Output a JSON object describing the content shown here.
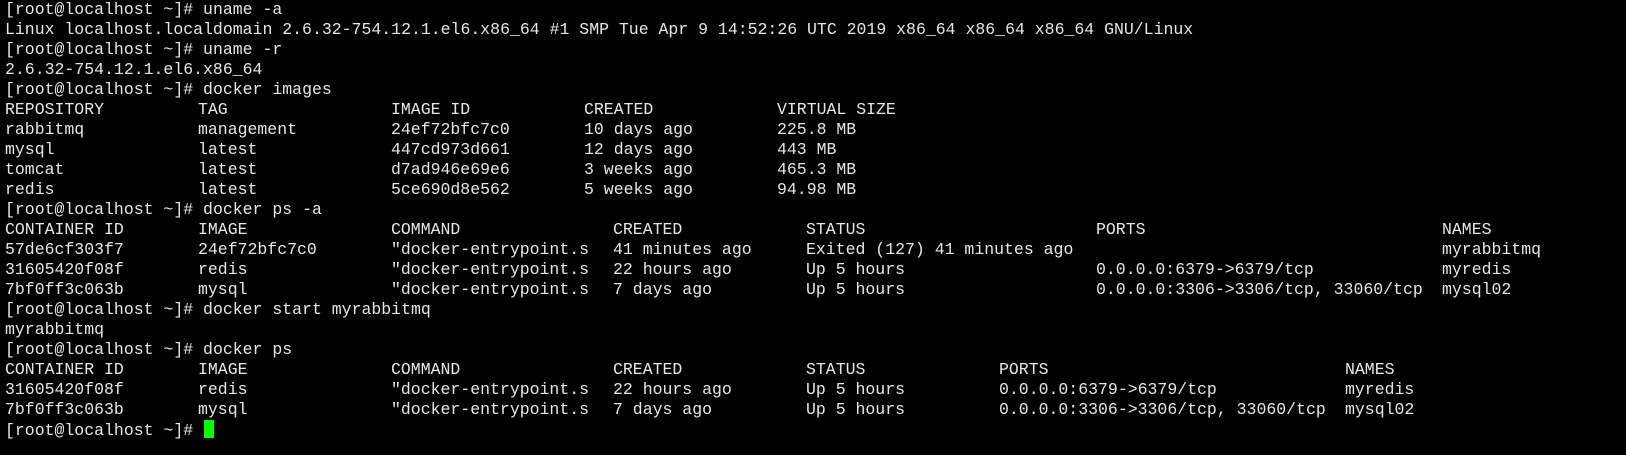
{
  "terminal": {
    "cursor_color": "#00ff00",
    "prompt": "[root@localhost ~]#",
    "lines": [
      {
        "kind": "prompt",
        "cmd": "uname -a"
      },
      {
        "kind": "text",
        "text": "Linux localhost.localdomain 2.6.32-754.12.1.el6.x86_64 #1 SMP Tue Apr 9 14:52:26 UTC 2019 x86_64 x86_64 x86_64 GNU/Linux"
      },
      {
        "kind": "prompt",
        "cmd": "uname -r"
      },
      {
        "kind": "text",
        "text": "2.6.32-754.12.1.el6.x86_64"
      },
      {
        "kind": "prompt",
        "cmd": "docker images"
      },
      {
        "kind": "row",
        "table": "images",
        "cells": [
          "REPOSITORY",
          "TAG",
          "IMAGE ID",
          "CREATED",
          "VIRTUAL SIZE"
        ]
      },
      {
        "kind": "row",
        "table": "images",
        "cells": [
          "rabbitmq",
          "management",
          "24ef72bfc7c0",
          "10 days ago",
          "225.8 MB"
        ]
      },
      {
        "kind": "row",
        "table": "images",
        "cells": [
          "mysql",
          "latest",
          "447cd973d661",
          "12 days ago",
          "443 MB"
        ]
      },
      {
        "kind": "row",
        "table": "images",
        "cells": [
          "tomcat",
          "latest",
          "d7ad946e69e6",
          "3 weeks ago",
          "465.3 MB"
        ]
      },
      {
        "kind": "row",
        "table": "images",
        "cells": [
          "redis",
          "latest",
          "5ce690d8e562",
          "5 weeks ago",
          "94.98 MB"
        ]
      },
      {
        "kind": "prompt",
        "cmd": "docker ps -a"
      },
      {
        "kind": "row",
        "table": "ps_all",
        "cells": [
          "CONTAINER ID",
          "IMAGE",
          "COMMAND",
          "CREATED",
          "STATUS",
          "PORTS",
          "NAMES"
        ]
      },
      {
        "kind": "row",
        "table": "ps_all",
        "cells": [
          "57de6cf303f7",
          "24ef72bfc7c0",
          "\"docker-entrypoint.s",
          "41 minutes ago",
          "Exited (127) 41 minutes ago",
          "",
          "myrabbitmq"
        ]
      },
      {
        "kind": "row",
        "table": "ps_all",
        "cells": [
          "31605420f08f",
          "redis",
          "\"docker-entrypoint.s",
          "22 hours ago",
          "Up 5 hours",
          "0.0.0.0:6379->6379/tcp",
          "myredis"
        ]
      },
      {
        "kind": "row",
        "table": "ps_all",
        "cells": [
          "7bf0ff3c063b",
          "mysql",
          "\"docker-entrypoint.s",
          "7 days ago",
          "Up 5 hours",
          "0.0.0.0:3306->3306/tcp, 33060/tcp",
          "mysql02"
        ]
      },
      {
        "kind": "prompt",
        "cmd": "docker start myrabbitmq"
      },
      {
        "kind": "text",
        "text": "myrabbitmq"
      },
      {
        "kind": "prompt",
        "cmd": "docker ps"
      },
      {
        "kind": "row",
        "table": "ps",
        "cells": [
          "CONTAINER ID",
          "IMAGE",
          "COMMAND",
          "CREATED",
          "STATUS",
          "PORTS",
          "NAMES"
        ]
      },
      {
        "kind": "row",
        "table": "ps",
        "cells": [
          "31605420f08f",
          "redis",
          "\"docker-entrypoint.s",
          "22 hours ago",
          "Up 5 hours",
          "0.0.0.0:6379->6379/tcp",
          "myredis"
        ]
      },
      {
        "kind": "row",
        "table": "ps",
        "cells": [
          "7bf0ff3c063b",
          "mysql",
          "\"docker-entrypoint.s",
          "7 days ago",
          "Up 5 hours",
          "0.0.0.0:3306->3306/tcp, 33060/tcp",
          "mysql02"
        ]
      },
      {
        "kind": "active_prompt",
        "cmd": ""
      }
    ]
  }
}
